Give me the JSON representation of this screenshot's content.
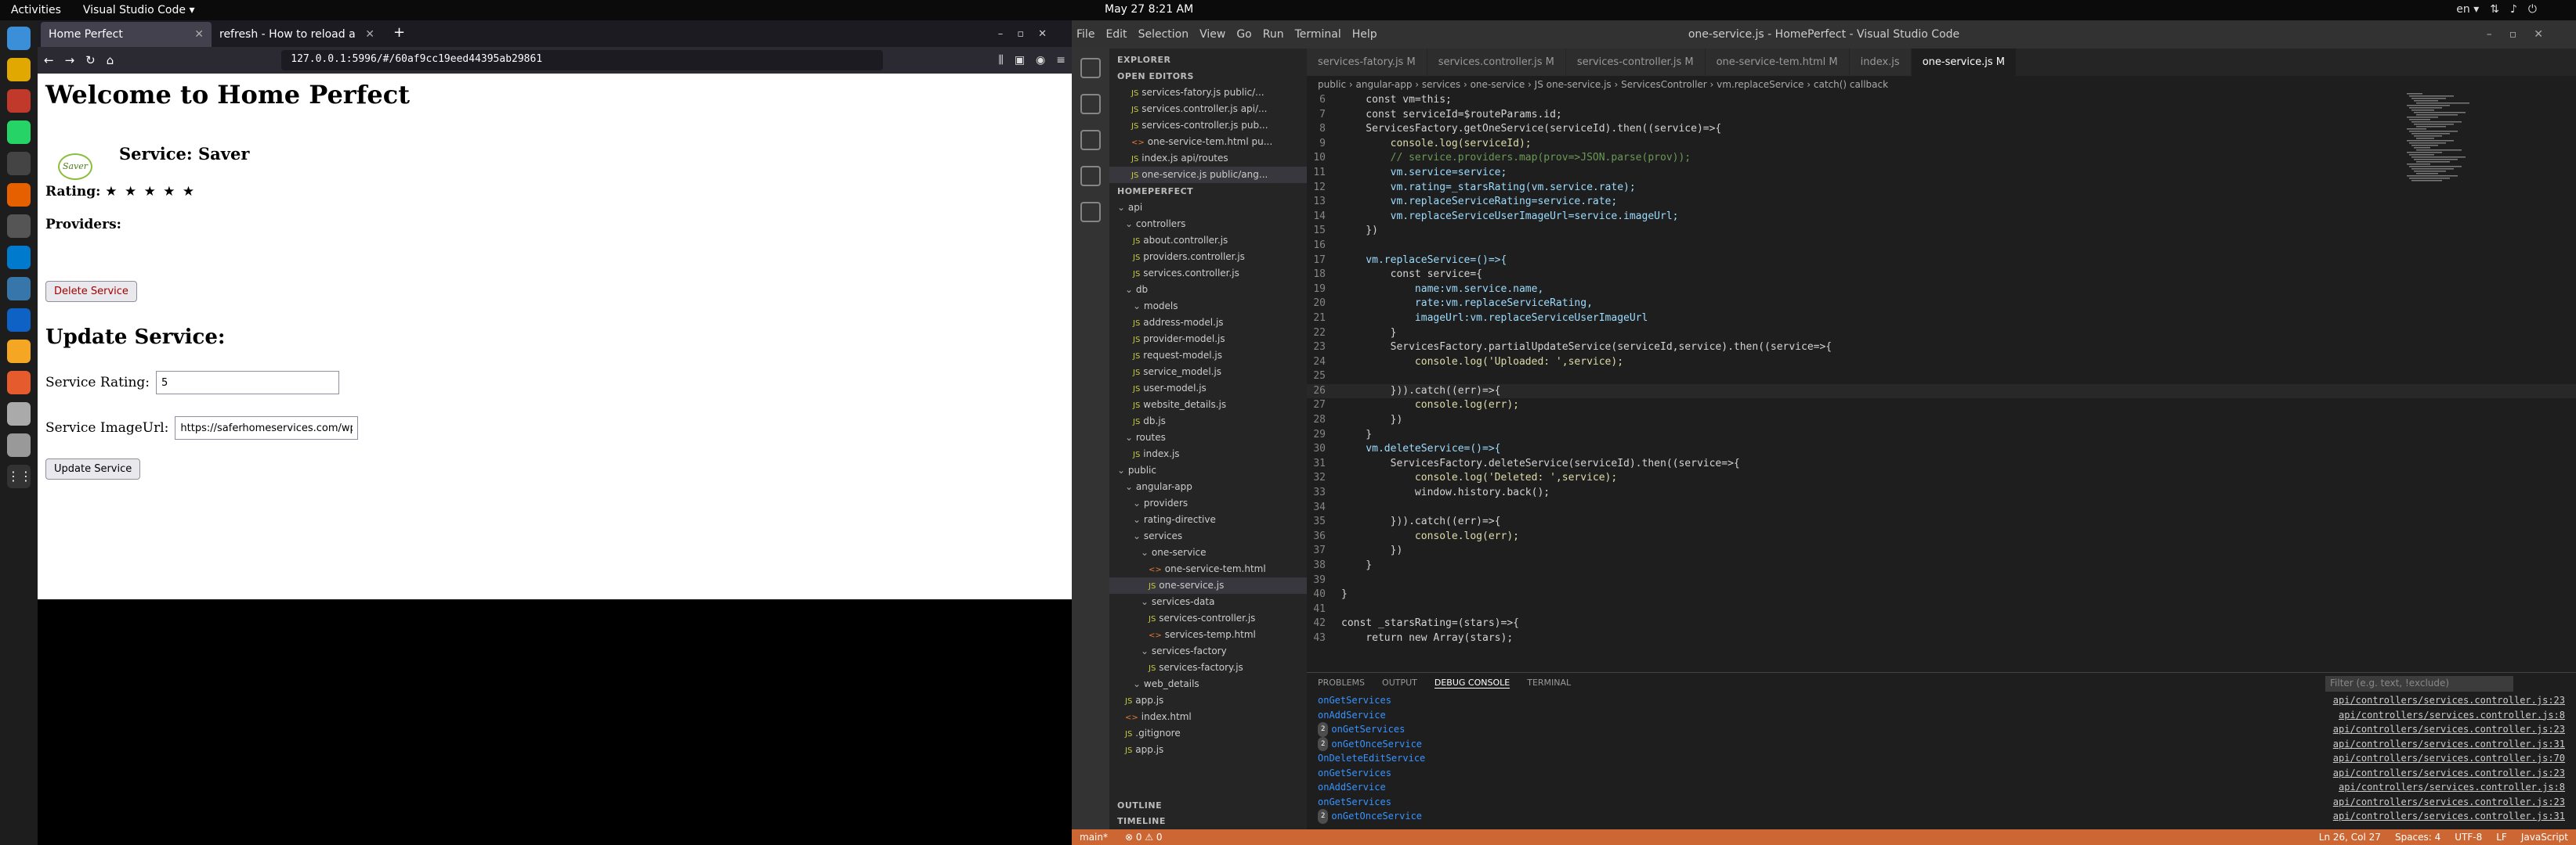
{
  "system": {
    "activities": "Activities",
    "active_app": "Visual Studio Code ▾",
    "clock": "May 27  8:21 AM",
    "lang": "en ▾"
  },
  "firefox": {
    "tabs": [
      {
        "label": "Home Perfect"
      },
      {
        "label": "refresh - How to reload a"
      }
    ],
    "url": "127.0.0.1:5996/#/60af9cc19eed44395ab29861",
    "page": {
      "heading": "Welcome to Home Perfect",
      "logo_text": "Saver",
      "service_title": "Service: Saver",
      "rating_label": "Rating:",
      "rating_stars": "★ ★ ★ ★ ★",
      "providers_label": "Providers:",
      "delete_button": "Delete Service",
      "update_heading": "Update Service:",
      "rating_field_label": "Service Rating:",
      "rating_value": "5",
      "image_field_label": "Service ImageUrl:",
      "image_value": "https://saferhomeservices.com/wp",
      "update_button": "Update Service"
    }
  },
  "vscode": {
    "title": "one-service.js - HomePerfect - Visual Studio Code",
    "menu": [
      "File",
      "Edit",
      "Selection",
      "View",
      "Go",
      "Run",
      "Terminal",
      "Help"
    ],
    "explorer_label": "EXPLORER",
    "open_editors_label": "OPEN EDITORS",
    "open_editors": [
      "services-fatory.js  public/...",
      "services.controller.js  api/...",
      "services-controller.js  pub...",
      "one-service-tem.html  pu...",
      "index.js  api/routes",
      "one-service.js  public/ang..."
    ],
    "project_label": "HOMEPERFECT",
    "tree": [
      "api",
      "controllers",
      "about.controller.js",
      "providers.controller.js",
      "services.controller.js",
      "db",
      "models",
      "address-model.js",
      "provider-model.js",
      "request-model.js",
      "service_model.js",
      "user-model.js",
      "website_details.js",
      "db.js",
      "routes",
      "index.js",
      "public",
      "angular-app",
      "providers",
      "rating-directive",
      "services",
      "one-service",
      "one-service-tem.html",
      "one-service.js",
      "services-data",
      "services-controller.js",
      "services-temp.html",
      "services-factory",
      "services-factory.js",
      "web_details",
      "app.js",
      "index.html",
      ".gitignore",
      "app.js"
    ],
    "outline_label": "OUTLINE",
    "timeline_label": "TIMELINE",
    "tabs": [
      "services-fatory.js M",
      "services.controller.js M",
      "services-controller.js M",
      "one-service-tem.html M",
      "index.js",
      "one-service.js M"
    ],
    "breadcrumbs": "public › angular-app › services › one-service › JS one-service.js › ServicesController › vm.replaceService › catch() callback",
    "code": [
      {
        "n": "6",
        "t": "    const vm=this;"
      },
      {
        "n": "7",
        "t": "    const serviceId=$routeParams.id;"
      },
      {
        "n": "8",
        "t": "    ServicesFactory.getOneService(serviceId).then((service)=>{"
      },
      {
        "n": "9",
        "t": "        console.log(serviceId);"
      },
      {
        "n": "10",
        "t": "        // service.providers.map(prov=>JSON.parse(prov));"
      },
      {
        "n": "11",
        "t": "        vm.service=service;"
      },
      {
        "n": "12",
        "t": "        vm.rating=_starsRating(vm.service.rate);"
      },
      {
        "n": "13",
        "t": "        vm.replaceServiceRating=service.rate;"
      },
      {
        "n": "14",
        "t": "        vm.replaceServiceUserImageUrl=service.imageUrl;"
      },
      {
        "n": "15",
        "t": "    })"
      },
      {
        "n": "16",
        "t": ""
      },
      {
        "n": "17",
        "t": "    vm.replaceService=()=>{"
      },
      {
        "n": "18",
        "t": "        const service={"
      },
      {
        "n": "19",
        "t": "            name:vm.service.name,"
      },
      {
        "n": "20",
        "t": "            rate:vm.replaceServiceRating,"
      },
      {
        "n": "21",
        "t": "            imageUrl:vm.replaceServiceUserImageUrl"
      },
      {
        "n": "22",
        "t": "        }"
      },
      {
        "n": "23",
        "t": "        ServicesFactory.partialUpdateService(serviceId,service).then((service=>{"
      },
      {
        "n": "24",
        "t": "            console.log('Uploaded: ',service);"
      },
      {
        "n": "25",
        "t": ""
      },
      {
        "n": "26",
        "t": "        })).catch((err)=>{"
      },
      {
        "n": "27",
        "t": "            console.log(err);"
      },
      {
        "n": "28",
        "t": "        })"
      },
      {
        "n": "29",
        "t": "    }"
      },
      {
        "n": "30",
        "t": "    vm.deleteService=()=>{"
      },
      {
        "n": "31",
        "t": "        ServicesFactory.deleteService(serviceId).then((service=>{"
      },
      {
        "n": "32",
        "t": "            console.log('Deleted: ',service);"
      },
      {
        "n": "33",
        "t": "            window.history.back();"
      },
      {
        "n": "34",
        "t": ""
      },
      {
        "n": "35",
        "t": "        })).catch((err)=>{"
      },
      {
        "n": "36",
        "t": "            console.log(err);"
      },
      {
        "n": "37",
        "t": "        })"
      },
      {
        "n": "38",
        "t": "    }"
      },
      {
        "n": "39",
        "t": ""
      },
      {
        "n": "40",
        "t": "}"
      },
      {
        "n": "41",
        "t": ""
      },
      {
        "n": "42",
        "t": "const _starsRating=(stars)=>{"
      },
      {
        "n": "43",
        "t": "    return new Array(stars);"
      }
    ],
    "panel_tabs": [
      "PROBLEMS",
      "OUTPUT",
      "DEBUG CONSOLE",
      "TERMINAL"
    ],
    "filter_placeholder": "Filter (e.g. text, !exclude)",
    "console": [
      {
        "badge": "",
        "msg": "onGetServices",
        "src": "api/controllers/services.controller.js:23"
      },
      {
        "badge": "",
        "msg": "onAddService",
        "src": "api/controllers/services.controller.js:8"
      },
      {
        "badge": "2",
        "msg": "onGetServices",
        "src": "api/controllers/services.controller.js:23"
      },
      {
        "badge": "2",
        "msg": "onGetOnceService",
        "src": "api/controllers/services.controller.js:31"
      },
      {
        "badge": "",
        "msg": "OnDeleteEditService",
        "src": "api/controllers/services.controller.js:70"
      },
      {
        "badge": "",
        "msg": "onGetServices",
        "src": "api/controllers/services.controller.js:23"
      },
      {
        "badge": "",
        "msg": "onAddService",
        "src": "api/controllers/services.controller.js:8"
      },
      {
        "badge": "",
        "msg": "onGetServices",
        "src": "api/controllers/services.controller.js:23"
      },
      {
        "badge": "2",
        "msg": "onGetOnceService",
        "src": "api/controllers/services.controller.js:31"
      }
    ],
    "status": {
      "branch": "main*",
      "errors": "⊗ 0 ⚠ 0",
      "position": "Ln 26, Col 27",
      "spaces": "Spaces: 4",
      "encoding": "UTF-8",
      "eol": "LF",
      "language": "JavaScript"
    }
  }
}
